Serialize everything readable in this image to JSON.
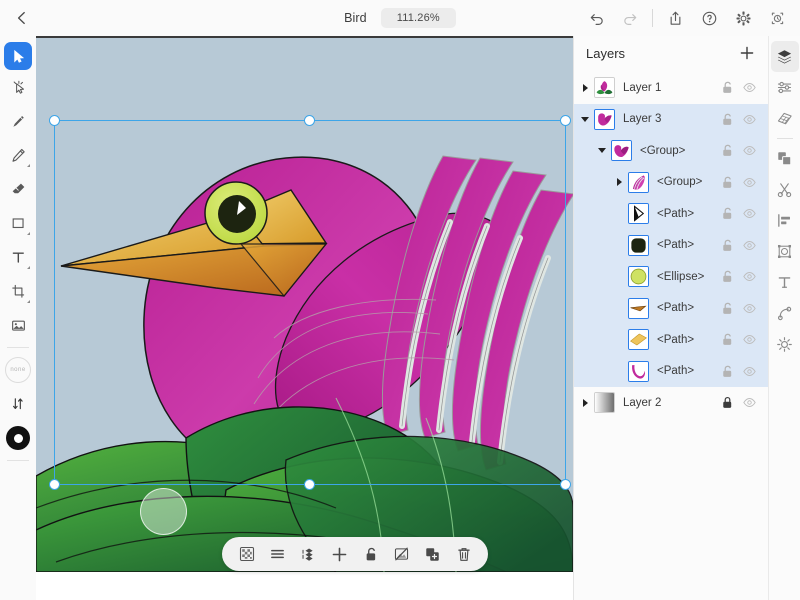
{
  "topbar": {
    "back_icon": "chevron-left-icon",
    "title": "Bird",
    "zoom_level": "111.26%",
    "actions": [
      {
        "name": "undo-button",
        "icon": "undo-icon"
      },
      {
        "name": "redo-button",
        "icon": "redo-icon"
      },
      {
        "name": "share-button",
        "icon": "share-export-icon"
      },
      {
        "name": "help-button",
        "icon": "question-circle-icon"
      },
      {
        "name": "settings-button",
        "icon": "gear-icon"
      },
      {
        "name": "snapshot-button",
        "icon": "snapshot-history-icon"
      }
    ]
  },
  "left_toolbar": {
    "tools": [
      {
        "name": "select-tool",
        "icon": "cursor-arrow-icon",
        "active": true,
        "submenu": false
      },
      {
        "name": "node-tool",
        "icon": "node-edit-icon",
        "active": false,
        "submenu": false
      },
      {
        "name": "pen-tool",
        "icon": "pen-icon",
        "active": false,
        "submenu": false
      },
      {
        "name": "pencil-tool",
        "icon": "pencil-icon",
        "active": false,
        "submenu": true
      },
      {
        "name": "eraser-tool",
        "icon": "eraser-icon",
        "active": false,
        "submenu": false
      },
      {
        "name": "rectangle-tool",
        "icon": "rectangle-icon",
        "active": false,
        "submenu": true
      },
      {
        "name": "text-tool",
        "icon": "text-t-icon",
        "active": false,
        "submenu": true
      },
      {
        "name": "crop-tool",
        "icon": "crop-icon",
        "active": false,
        "submenu": true
      },
      {
        "name": "image-tool",
        "icon": "image-icon",
        "active": false,
        "submenu": false
      }
    ],
    "fill_swatch_label": "none",
    "stroke_swap_icon": "swap-arrows-icon",
    "stroke_donut_icon": "stroke-donut-icon"
  },
  "canvas": {
    "background_color": "#b7c9d6",
    "artwork_name": "bird-illustration",
    "selection": {
      "handle_count": 6,
      "grip_icon": "rotate-grip-handle"
    },
    "colors": {
      "bird_body": "#c0249a",
      "bird_body_light": "#d14fb6",
      "beak_light": "#eec34f",
      "beak_dark": "#cd7d20",
      "eye_ring": "#c5de4a",
      "eye_pupil": "#1d2410",
      "leaf_green_light": "#4aa83a",
      "leaf_green_dark": "#1c5c33",
      "selection_blue": "#3da5e8"
    }
  },
  "float_toolbar": {
    "buttons": [
      {
        "name": "transparency-button",
        "icon": "checkerboard-icon"
      },
      {
        "name": "align-button",
        "icon": "lines-align-icon"
      },
      {
        "name": "arrange-button",
        "icon": "arrange-order-icon"
      },
      {
        "name": "move-button",
        "icon": "move-cross-icon"
      },
      {
        "name": "unlock-button",
        "icon": "unlock-padlock-icon"
      },
      {
        "name": "hide-button",
        "icon": "hide-slash-icon"
      },
      {
        "name": "duplicate-button",
        "icon": "duplicate-plus-icon"
      },
      {
        "name": "delete-button",
        "icon": "trash-icon"
      }
    ]
  },
  "layers_panel": {
    "title": "Layers",
    "add_icon": "plus-icon",
    "lock_icon_open": "padlock-open-icon",
    "lock_icon_closed": "padlock-closed-icon",
    "eye_icon": "eye-visibility-icon",
    "rows": [
      {
        "name": "Layer 1",
        "indent": 0,
        "disclosure": "collapsed",
        "selected": false,
        "locked": false,
        "thumb": "flower-leaves-thumb",
        "thumb_highlight": false
      },
      {
        "name": "Layer 3",
        "indent": 0,
        "disclosure": "expanded",
        "selected": true,
        "locked": false,
        "thumb": "bird-thumb",
        "thumb_highlight": true
      },
      {
        "name": "<Group>",
        "indent": 1,
        "disclosure": "expanded",
        "selected": true,
        "locked": false,
        "thumb": "bird-group-thumb",
        "thumb_highlight": true
      },
      {
        "name": "<Group>",
        "indent": 2,
        "disclosure": "collapsed",
        "selected": true,
        "locked": false,
        "thumb": "wing-feathers-thumb",
        "thumb_highlight": true
      },
      {
        "name": "<Path>",
        "indent": 2,
        "disclosure": "none",
        "selected": true,
        "locked": false,
        "thumb": "triangle-path-thumb",
        "thumb_highlight": true
      },
      {
        "name": "<Path>",
        "indent": 2,
        "disclosure": "none",
        "selected": true,
        "locked": false,
        "thumb": "dark-blob-thumb",
        "thumb_highlight": true
      },
      {
        "name": "<Ellipse>",
        "indent": 2,
        "disclosure": "none",
        "selected": true,
        "locked": false,
        "thumb": "yellow-ellipse-thumb",
        "thumb_highlight": true
      },
      {
        "name": "<Path>",
        "indent": 2,
        "disclosure": "none",
        "selected": true,
        "locked": false,
        "thumb": "beak-dark-thumb",
        "thumb_highlight": true
      },
      {
        "name": "<Path>",
        "indent": 2,
        "disclosure": "none",
        "selected": true,
        "locked": false,
        "thumb": "beak-light-thumb",
        "thumb_highlight": true
      },
      {
        "name": "<Path>",
        "indent": 2,
        "disclosure": "none",
        "selected": true,
        "locked": false,
        "thumb": "magenta-curve-thumb",
        "thumb_highlight": true
      },
      {
        "name": "Layer 2",
        "indent": 0,
        "disclosure": "collapsed",
        "selected": false,
        "locked": true,
        "thumb": "gradient-gray-thumb",
        "thumb_highlight": false
      }
    ]
  },
  "right_rail": {
    "buttons": [
      {
        "name": "layers-panel-tab",
        "icon": "layers-stack-icon",
        "active": true
      },
      {
        "name": "adjustments-tab",
        "icon": "sliders-icon",
        "active": false
      },
      {
        "name": "grid-perspective-tab",
        "icon": "grid-perspective-icon",
        "active": false
      },
      {
        "name": "duplicate-tab",
        "icon": "copy-squares-icon",
        "active": false
      },
      {
        "name": "scissors-tab",
        "icon": "scissors-icon",
        "active": false
      },
      {
        "name": "align-tab",
        "icon": "align-left-icon",
        "active": false
      },
      {
        "name": "transform-tab",
        "icon": "transform-frame-icon",
        "active": false
      },
      {
        "name": "text-style-tab",
        "icon": "text-t-icon",
        "active": false
      },
      {
        "name": "node-curve-tab",
        "icon": "bezier-curve-icon",
        "active": false
      },
      {
        "name": "effects-tab",
        "icon": "effects-gear-icon",
        "active": false
      }
    ]
  }
}
